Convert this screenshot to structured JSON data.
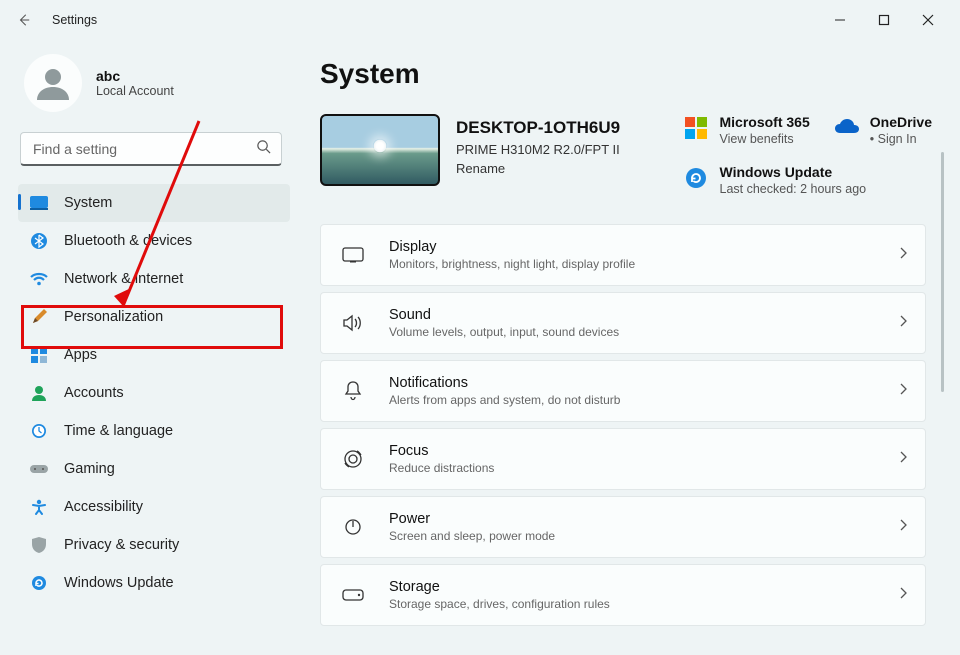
{
  "window": {
    "title": "Settings"
  },
  "account": {
    "name": "abc",
    "subtitle": "Local Account"
  },
  "search": {
    "placeholder": "Find a setting"
  },
  "sidebar": {
    "items": [
      {
        "label": "System"
      },
      {
        "label": "Bluetooth & devices"
      },
      {
        "label": "Network & internet"
      },
      {
        "label": "Personalization"
      },
      {
        "label": "Apps"
      },
      {
        "label": "Accounts"
      },
      {
        "label": "Time & language"
      },
      {
        "label": "Gaming"
      },
      {
        "label": "Accessibility"
      },
      {
        "label": "Privacy & security"
      },
      {
        "label": "Windows Update"
      }
    ]
  },
  "page": {
    "heading": "System",
    "device": {
      "name": "DESKTOP-1OTH6U9",
      "model": "PRIME H310M2 R2.0/FPT II",
      "rename": "Rename"
    },
    "quick": {
      "m365": {
        "title": "Microsoft 365",
        "sub": "View benefits"
      },
      "onedrive": {
        "title": "OneDrive",
        "sub": "Sign In"
      },
      "wu": {
        "title": "Windows Update",
        "sub": "Last checked: 2 hours ago"
      }
    },
    "cards": [
      {
        "title": "Display",
        "sub": "Monitors, brightness, night light, display profile"
      },
      {
        "title": "Sound",
        "sub": "Volume levels, output, input, sound devices"
      },
      {
        "title": "Notifications",
        "sub": "Alerts from apps and system, do not disturb"
      },
      {
        "title": "Focus",
        "sub": "Reduce distractions"
      },
      {
        "title": "Power",
        "sub": "Screen and sleep, power mode"
      },
      {
        "title": "Storage",
        "sub": "Storage space, drives, configuration rules"
      }
    ]
  }
}
